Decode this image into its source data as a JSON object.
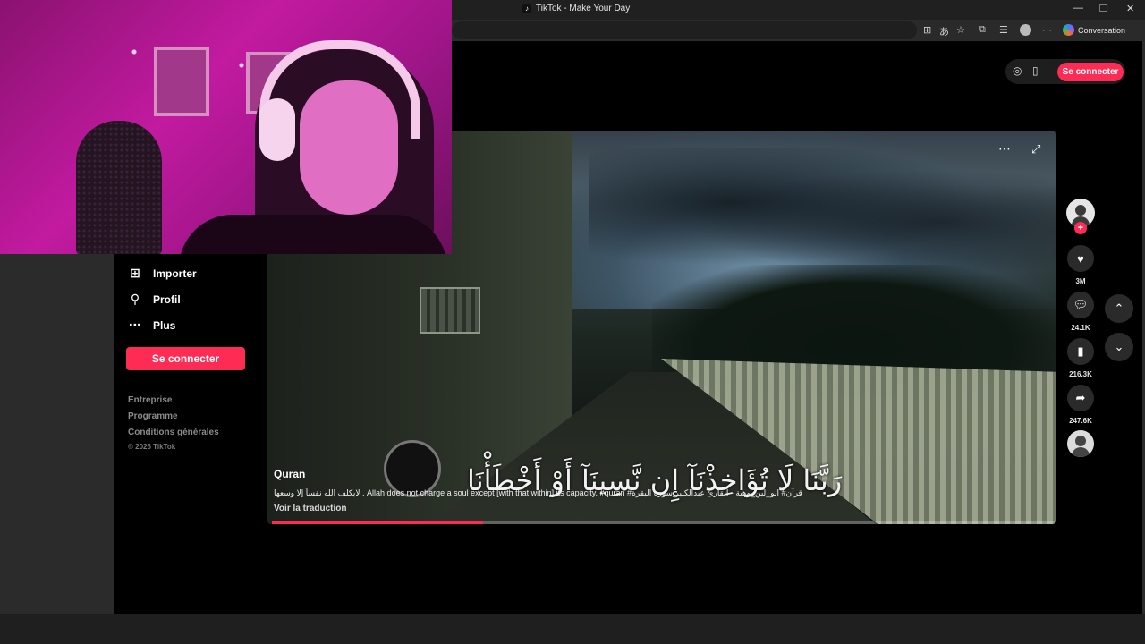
{
  "browser": {
    "tab_title": "TikTok - Make Your Day",
    "conversation_label": "Conversation",
    "window_controls": {
      "minimize": "—",
      "restore": "❐",
      "close": "✕"
    }
  },
  "sidebar": {
    "items": [
      {
        "icon": "plus-square-icon",
        "label": "Importer"
      },
      {
        "icon": "user-icon",
        "label": "Profil"
      },
      {
        "icon": "more-icon",
        "label": "Plus"
      }
    ],
    "login_label": "Se connecter",
    "footer_links": [
      "Entreprise",
      "Programme",
      "Conditions générales"
    ],
    "copyright": "© 2026 TikTok"
  },
  "header": {
    "login_label": "Se connecter"
  },
  "video": {
    "overlay_text": "رَبَّنَا لَا تُؤَاخِذْنَآ إِن نَّسِينَآ أَوْ أَخْطَأْنَا",
    "author": "Quran",
    "caption": "لايكلف الله نفساً إلا وسعها . Allah does not charge a soul except [with that within] its capacity. #quran #قرآن# ابو_لبن_وهبة - القارئ عبدالكبير سورة البقرة",
    "translate_label": "Voir la traduction",
    "progress": 0.27
  },
  "actions": {
    "likes": "3M",
    "comments": "24.1K",
    "saves": "216.3K",
    "shares": "247.6K",
    "follow_symbol": "+"
  },
  "colors": {
    "accent": "#fe2c55",
    "page_bg": "#000000",
    "webcam_tint": "#c21aa0"
  }
}
